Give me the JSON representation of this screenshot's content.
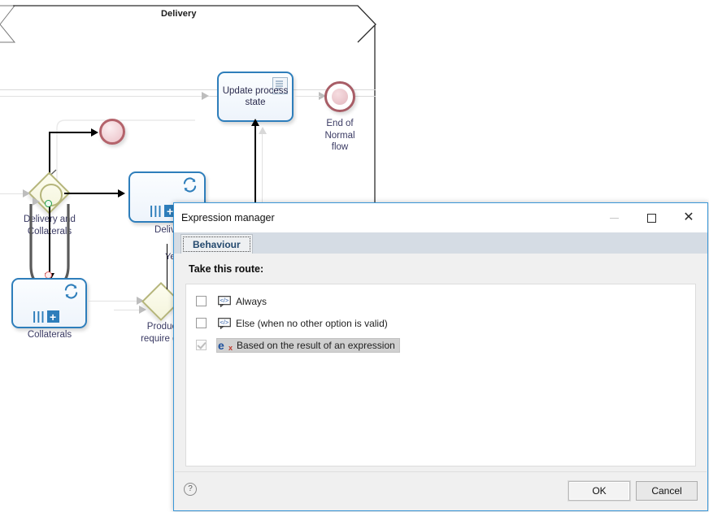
{
  "diagram": {
    "pool_label": "Delivery",
    "shapes": {
      "update_task": "Update process state",
      "end_normal": "End of\nNormal\nflow",
      "gateway_delivery": "Delivery and\nCollaterals",
      "gateway_product": "Produc\nrequire de",
      "subprocess_delivery": "Delive",
      "subprocess_collaterals": "Collaterals"
    },
    "edge_labels": {
      "yes": "Ye"
    },
    "icon_names": {
      "loop_marker": "loop-marker-icon",
      "parallel_multi_instance": "parallel-multi-instance-icon",
      "expand_subprocess": "expand-plus-icon",
      "script_task": "script-document-icon"
    }
  },
  "dialog": {
    "title": "Expression manager",
    "window_buttons": {
      "minimize": "minimize-button",
      "maximize": "maximize-button",
      "close": "close-button"
    },
    "tabs": [
      {
        "label": "Behaviour",
        "active": true
      }
    ],
    "section_title": "Take this route:",
    "options": [
      {
        "label": "Always",
        "checked": false,
        "selected": false,
        "icon": "expression-bubble-icon"
      },
      {
        "label": "Else (when no other option is valid)",
        "checked": false,
        "selected": false,
        "icon": "expression-bubble-icon"
      },
      {
        "label": "Based on the result of an expression",
        "checked": true,
        "selected": true,
        "icon": "expression-ex-icon"
      }
    ],
    "footer": {
      "help": "?",
      "ok": "OK",
      "cancel": "Cancel"
    }
  },
  "colors": {
    "accent": "#3a97d8",
    "task_border": "#2e7ebb",
    "gateway_border": "#b5b57a",
    "event_border": "#a85d66",
    "selection": "#d0d0d0"
  }
}
